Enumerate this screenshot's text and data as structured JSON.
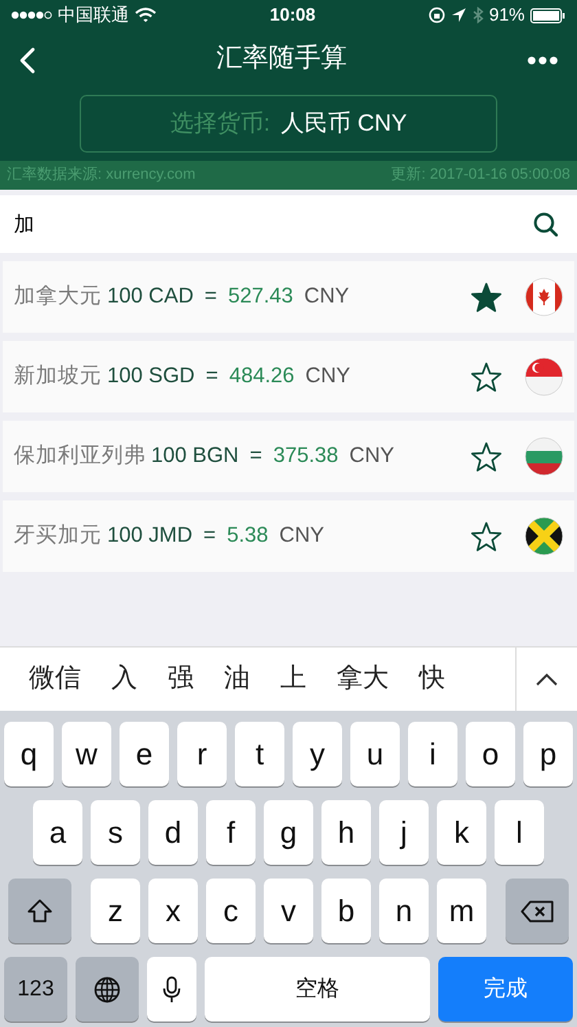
{
  "status_bar": {
    "carrier": "中国联通",
    "time": "10:08",
    "battery": "91%"
  },
  "nav": {
    "title": "汇率随手算"
  },
  "selector": {
    "label": "选择货币:",
    "value": "人民币 CNY"
  },
  "info": {
    "source": "汇率数据来源: xurrency.com",
    "updated": "更新: 2017-01-16 05:00:08"
  },
  "search": {
    "value": "加"
  },
  "rates": [
    {
      "name": "加拿大元",
      "amount": "100 CAD",
      "equals": "=",
      "value": "527.43",
      "unit": "CNY",
      "starred": true
    },
    {
      "name": "新加坡元",
      "amount": "100 SGD",
      "equals": "=",
      "value": "484.26",
      "unit": "CNY",
      "starred": false
    },
    {
      "name": "保加利亚列弗",
      "amount": "100 BGN",
      "equals": "=",
      "value": "375.38",
      "unit": "CNY",
      "starred": false
    },
    {
      "name": "牙买加元",
      "amount": "100 JMD",
      "equals": "=",
      "value": "5.38",
      "unit": "CNY",
      "starred": false
    }
  ],
  "candidates": [
    "微信",
    "入",
    "强",
    "油",
    "上",
    "拿大",
    "快"
  ],
  "keyboard": [
    [
      {
        "kind": "letter",
        "label": "q"
      },
      {
        "kind": "letter",
        "label": "w"
      },
      {
        "kind": "letter",
        "label": "e"
      },
      {
        "kind": "letter",
        "label": "r"
      },
      {
        "kind": "letter",
        "label": "t"
      },
      {
        "kind": "letter",
        "label": "y"
      },
      {
        "kind": "letter",
        "label": "u"
      },
      {
        "kind": "letter",
        "label": "i"
      },
      {
        "kind": "letter",
        "label": "o"
      },
      {
        "kind": "letter",
        "label": "p"
      }
    ],
    [
      {
        "kind": "letter",
        "label": "a"
      },
      {
        "kind": "letter",
        "label": "s"
      },
      {
        "kind": "letter",
        "label": "d"
      },
      {
        "kind": "letter",
        "label": "f"
      },
      {
        "kind": "letter",
        "label": "g"
      },
      {
        "kind": "letter",
        "label": "h"
      },
      {
        "kind": "letter",
        "label": "j"
      },
      {
        "kind": "letter",
        "label": "k"
      },
      {
        "kind": "letter",
        "label": "l"
      }
    ],
    [
      {
        "kind": "shift"
      },
      {
        "kind": "letter",
        "label": "z"
      },
      {
        "kind": "letter",
        "label": "x"
      },
      {
        "kind": "letter",
        "label": "c"
      },
      {
        "kind": "letter",
        "label": "v"
      },
      {
        "kind": "letter",
        "label": "b"
      },
      {
        "kind": "letter",
        "label": "n"
      },
      {
        "kind": "letter",
        "label": "m"
      },
      {
        "kind": "delete"
      }
    ],
    [
      {
        "kind": "numbers",
        "label": "123"
      },
      {
        "kind": "globe"
      },
      {
        "kind": "mic"
      },
      {
        "kind": "space",
        "label": "空格"
      },
      {
        "kind": "done",
        "label": "完成"
      }
    ]
  ]
}
